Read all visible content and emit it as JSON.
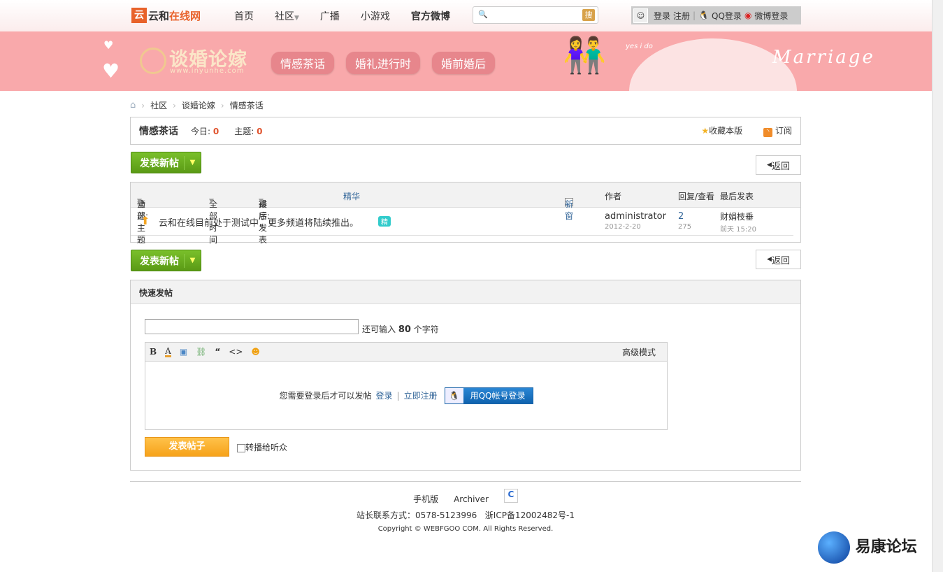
{
  "topbar": {
    "logo_text_a": "云和",
    "logo_text_b": "在线网",
    "logo_sub": "inyunhe",
    "nav": [
      "首页",
      "社区",
      "广播",
      "小游戏",
      "官方微博"
    ],
    "search_btn": "搜",
    "login": "登录",
    "register": "注册",
    "qq_login": "QQ登录",
    "weibo_login": "微博登录"
  },
  "banner": {
    "title": "谈婚论嫁",
    "url": "www.inyunhe.com",
    "tabs": [
      "情感茶话",
      "婚礼进行时",
      "婚前婚后"
    ],
    "deco_text": "Marriage",
    "deco_sub": "yes i do"
  },
  "breadcrumb": [
    "社区",
    "谈婚论嫁",
    "情感茶话"
  ],
  "forum": {
    "name": "情感茶话",
    "today_label": "今日:",
    "today": "0",
    "topics_label": "主题:",
    "topics": "0",
    "favorite": "收藏本版",
    "subscribe": "订阅"
  },
  "new_post": "发表新帖",
  "back": "返回",
  "table": {
    "filter_label": "筛选:",
    "filter_all": "全部主题",
    "time_all": "全部时间",
    "sort_label": "排序:",
    "sort_value": "最后发表",
    "digest": "精华",
    "new_window": "新窗",
    "col_author": "作者",
    "col_replies": "回复/查看",
    "col_last": "最后发表",
    "rows": [
      {
        "title": "云和在线目前处于测试中，更多频道将陆续推出。",
        "badge": "精",
        "author": "administrator",
        "date": "2012-2-20",
        "replies": "2",
        "views": "275",
        "last_user": "财娟枝垂",
        "last_time": "前天 15:20"
      }
    ]
  },
  "quick": {
    "title": "快速发帖",
    "remain_pre": "还可输入",
    "remain": "80",
    "remain_post": "个字符",
    "advanced": "高级模式",
    "need_login": "您需要登录后才可以发帖",
    "login": "登录",
    "register": "立即注册",
    "qq_btn": "用QQ帐号登录",
    "submit": "发表帖子",
    "broadcast": "转播给听众"
  },
  "footer": {
    "mobile": "手机版",
    "archiver": "Archiver",
    "contact": "站长联系方式：0578-5123996",
    "icp": "浙ICP备12002482号-1",
    "copyright": "Copyright © WEBFGOO COM. All Rights Reserved."
  },
  "watermark": "易康论坛"
}
